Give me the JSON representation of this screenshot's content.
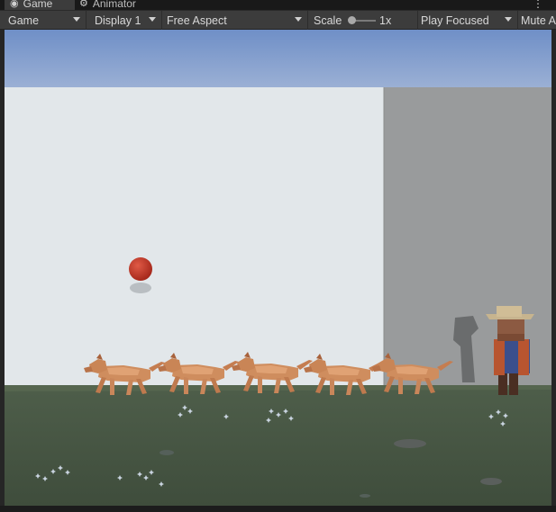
{
  "tabs": [
    {
      "label": "Game",
      "icon": "gamepad-icon",
      "active": true
    },
    {
      "label": "Animator",
      "icon": "animator-icon",
      "active": false
    }
  ],
  "toolbar": {
    "mode": "Game",
    "display": "Display 1",
    "aspect": "Free Aspect",
    "scale_label": "Scale",
    "scale_value": "1x",
    "play_mode": "Play Focused",
    "mute": "Mute A"
  },
  "colors": {
    "sky": "#7090c8",
    "wall": "#e2e7ea",
    "wall_side": "#9a9c9d",
    "ground": "#4b5a47",
    "ball": "#c13a2a",
    "dog": "#cf8d5e"
  },
  "scene": {
    "dog_count": 5,
    "objects": [
      "red-ball",
      "dog",
      "farmer-character"
    ]
  }
}
